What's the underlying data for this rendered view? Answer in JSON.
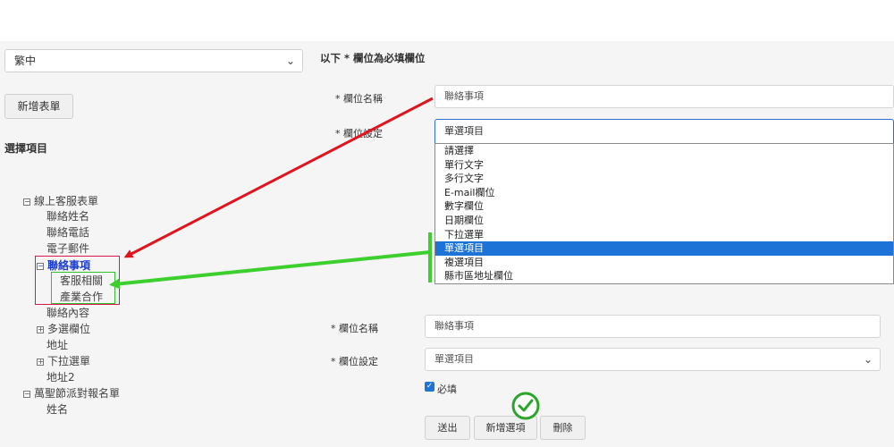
{
  "language_select": {
    "value": "繁中"
  },
  "add_form_button": "新增表單",
  "select_item_heading": "選擇項目",
  "required_note": "以下 * 欄位為必填欄位",
  "top_form": {
    "field_name_label": "* 欄位名稱",
    "field_name_value": "聯絡事項",
    "field_setting_label": "* 欄位設定",
    "field_setting_value": "單選項目",
    "options": [
      "請選擇",
      "單行文字",
      "多行文字",
      "E-mail欄位",
      "數字欄位",
      "日期欄位",
      "下拉選單",
      "單選項目",
      "複選項目",
      "縣市區地址欄位"
    ],
    "selected_option": "單選項目"
  },
  "tree": {
    "root1": "線上客服表單",
    "contact_name": "聯絡姓名",
    "contact_phone": "聯絡電話",
    "email": "電子郵件",
    "contact_matters": "聯絡事項",
    "sub1": "客服相關",
    "sub2": "產業合作",
    "contact_content": "聯絡內容",
    "multi_select": "多選欄位",
    "address": "地址",
    "dropdown": "下拉選單",
    "address2": "地址2",
    "root2": "萬聖節派對報名單",
    "name": "姓名"
  },
  "bottom_form": {
    "field_name_label": "* 欄位名稱",
    "field_name_value": "聯絡事項",
    "field_setting_label": "* 欄位設定",
    "field_setting_value": "單選項目",
    "required_label": "必填",
    "submit_button": "送出",
    "add_option_button": "新增選項",
    "delete_button": "刪除"
  },
  "colors": {
    "arrow_red": "#e0141e",
    "arrow_green": "#3ccf2e",
    "highlight_red": "#d9184f",
    "highlight_green": "#2ec22e",
    "selected_blue": "#1e73d6",
    "check_green": "#2aa52a"
  }
}
